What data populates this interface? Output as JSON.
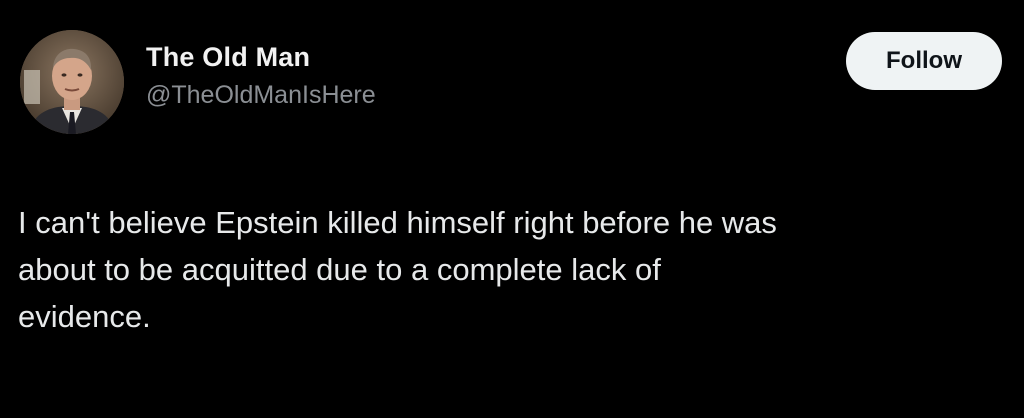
{
  "user": {
    "display_name": "The Old Man",
    "handle": "@TheOldManIsHere"
  },
  "actions": {
    "follow_label": "Follow"
  },
  "tweet": {
    "text": "I can't believe Epstein killed himself right before he was\nabout to be acquitted due to a complete lack of\nevidence."
  },
  "colors": {
    "background": "#000000",
    "text": "#e7e9ea",
    "handle": "#8b8f94",
    "follow_bg": "#eff3f4",
    "follow_text": "#0f1419"
  }
}
